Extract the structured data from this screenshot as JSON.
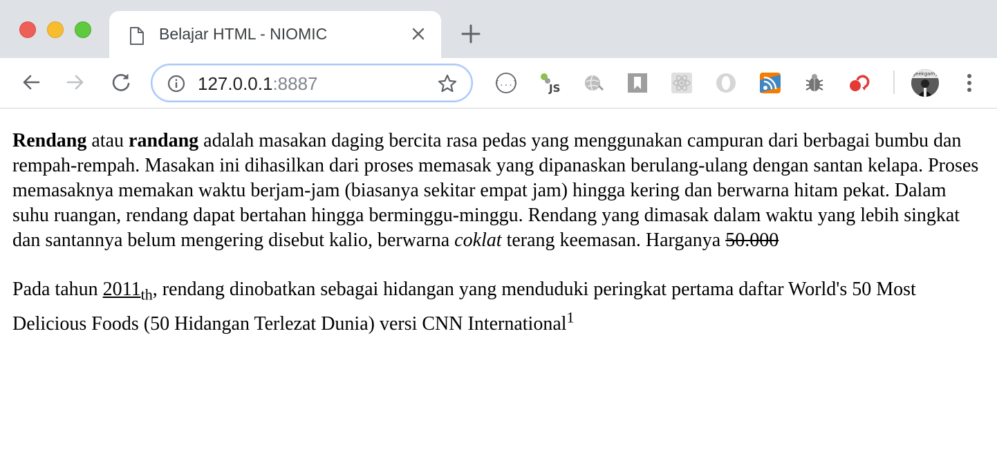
{
  "browser": {
    "tab": {
      "title": "Belajar HTML - NIOMIC",
      "icon": "document-icon"
    },
    "address": {
      "host": "127.0.0.1",
      "port": ":8887"
    },
    "extensions": [
      "json-formatter",
      "js-toggle",
      "web-developer",
      "bookmark",
      "react-devtools",
      "opera-o",
      "rss",
      "bug",
      "aws-s3"
    ],
    "avatar_label": "geekgamy",
    "colors": {
      "tabstrip": "#dee1e6",
      "omnibox_border": "#a8c7fa"
    }
  },
  "article": {
    "p1": {
      "w1": "Rendang",
      "t1": " atau ",
      "w2": "randang",
      "t2": " adalah masakan daging bercita rasa pedas yang menggunakan campuran dari berbagai bumbu dan rempah-rempah. Masakan ini dihasilkan dari proses memasak yang dipanaskan berulang-ulang dengan santan kelapa. Proses memasaknya memakan waktu berjam-jam (biasanya sekitar empat jam) hingga kering dan berwarna hitam pekat. Dalam suhu ruangan, rendang dapat bertahan hingga berminggu-minggu. Rendang yang dimasak dalam waktu yang lebih singkat dan santannya belum mengering disebut kalio, berwarna ",
      "em": "coklat",
      "t3": " terang keemasan. Harganya ",
      "price": "50.000"
    },
    "p2": {
      "t1": "Pada tahun ",
      "year": "2011",
      "sub": "th",
      "t2": ", rendang dinobatkan sebagai hidangan yang menduduki peringkat pertama daftar World's 50 Most Delicious Foods (50 Hidangan Terlezat Dunia) versi CNN International",
      "sup": "1"
    }
  }
}
